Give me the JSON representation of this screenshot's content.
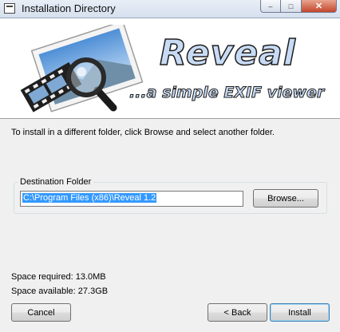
{
  "window": {
    "title": "Installation Directory",
    "minimize_label": "–",
    "maximize_label": "□",
    "close_label": "✕"
  },
  "banner": {
    "brand": "Reveal",
    "tagline": "...a simple EXIF viewer",
    "logo_icon": "magnifier-over-photo-film-icon"
  },
  "instruction": "To install in a different folder, click Browse and select another folder.",
  "destination": {
    "legend": "Destination Folder",
    "path": "C:\\Program Files (x86)\\Reveal 1.2",
    "browse_label": "Browse..."
  },
  "space": {
    "required": "Space required: 13.0MB",
    "available": "Space available: 27.3GB"
  },
  "buttons": {
    "cancel": "Cancel",
    "back": "< Back",
    "install": "Install"
  }
}
